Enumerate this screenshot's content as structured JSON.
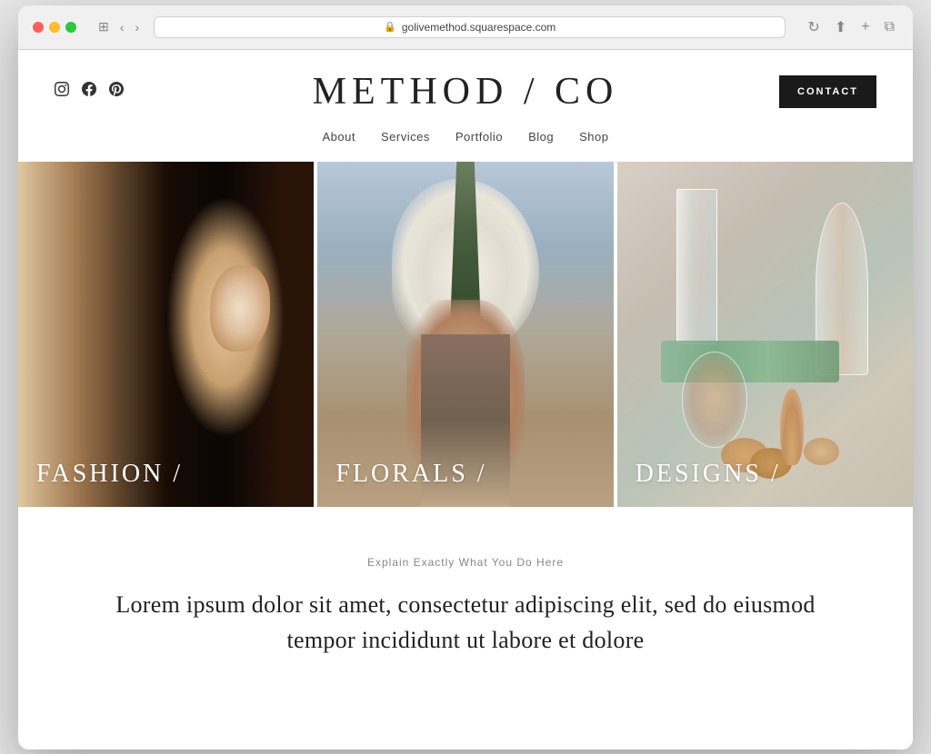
{
  "browser": {
    "url": "golivemethod.squarespace.com",
    "back_btn": "‹",
    "forward_btn": "›"
  },
  "header": {
    "site_title": "METHOD / CO",
    "contact_btn": "CONTACT",
    "social": {
      "instagram": "IG",
      "facebook": "f",
      "pinterest": "P"
    }
  },
  "nav": {
    "items": [
      {
        "label": "About",
        "id": "about"
      },
      {
        "label": "Services",
        "id": "services"
      },
      {
        "label": "Portfolio",
        "id": "portfolio"
      },
      {
        "label": "Blog",
        "id": "blog"
      },
      {
        "label": "Shop",
        "id": "shop"
      }
    ]
  },
  "gallery": {
    "items": [
      {
        "label": "FASHION /",
        "id": "fashion"
      },
      {
        "label": "FLORALS /",
        "id": "florals"
      },
      {
        "label": "DESIGNS /",
        "id": "designs"
      }
    ]
  },
  "description": {
    "subtitle": "Explain Exactly What You Do Here",
    "body": "Lorem ipsum dolor sit amet, consectetur adipiscing elit, sed do eiusmod tempor incididunt ut labore et dolore"
  }
}
